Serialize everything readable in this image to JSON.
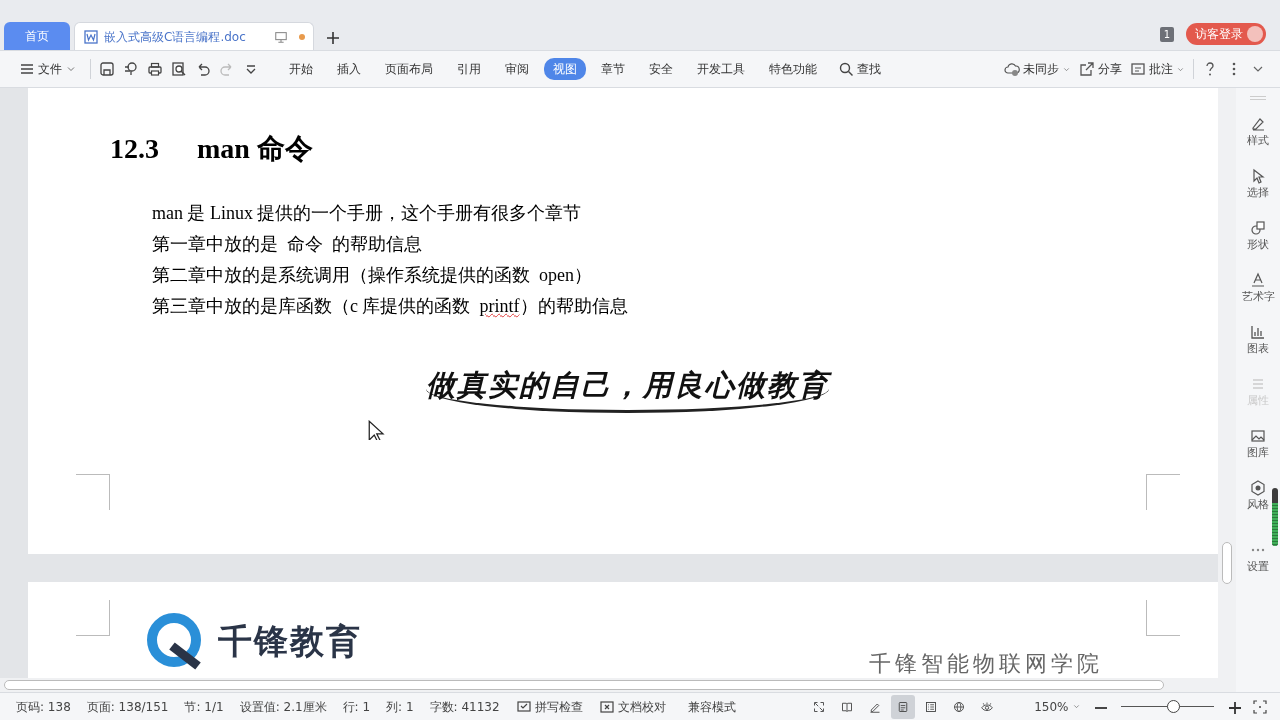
{
  "tabs": [
    {
      "label": "首页",
      "kind": "home",
      "selected": false
    },
    {
      "label": "嵌入式高级C语言编程.doc",
      "kind": "document",
      "selected": true,
      "modified": true
    }
  ],
  "window_count": "1",
  "login_button": "访客登录",
  "file_menu": "文件",
  "ribbon_tabs": [
    {
      "label": "开始",
      "selected": false
    },
    {
      "label": "插入",
      "selected": false
    },
    {
      "label": "页面布局",
      "selected": false
    },
    {
      "label": "引用",
      "selected": false
    },
    {
      "label": "审阅",
      "selected": false
    },
    {
      "label": "视图",
      "selected": true
    },
    {
      "label": "章节",
      "selected": false
    },
    {
      "label": "安全",
      "selected": false
    },
    {
      "label": "开发工具",
      "selected": false
    },
    {
      "label": "特色功能",
      "selected": false
    }
  ],
  "search": "查找",
  "right_actions": [
    {
      "label": "未同步",
      "kind": "sync"
    },
    {
      "label": "分享",
      "kind": "share"
    },
    {
      "label": "批注",
      "kind": "comment"
    }
  ],
  "document": {
    "heading_number": "12.3",
    "heading_title": "man 命令",
    "paragraphs": [
      [
        {
          "text": "man 是 Linux 提供的一个手册，这个手册有很多个章节",
          "misspelled": false
        }
      ],
      [
        {
          "text": "第一章中放的是  命令  的帮助信息",
          "misspelled": false
        }
      ],
      [
        {
          "text": "第二章中放的是系统调用（操作系统提供的函数  open）",
          "misspelled": false
        }
      ],
      [
        {
          "text": "第三章中放的是库函数（c 库提供的函数  ",
          "misspelled": false
        },
        {
          "text": "printf",
          "misspelled": true
        },
        {
          "text": "）的帮助信息",
          "misspelled": false
        }
      ]
    ],
    "slogan": "做真实的自己，用良心做教育",
    "logo_text": "千锋教育",
    "subtitle": "千锋智能物联网学院"
  },
  "side_panel": [
    {
      "label": "样式",
      "kind": "style",
      "disabled": false
    },
    {
      "label": "选择",
      "kind": "select",
      "disabled": false
    },
    {
      "label": "形状",
      "kind": "shape",
      "disabled": false
    },
    {
      "label": "艺术字",
      "kind": "art",
      "disabled": false
    },
    {
      "label": "图表",
      "kind": "chart",
      "disabled": false
    },
    {
      "label": "属性",
      "kind": "props",
      "disabled": true
    },
    {
      "label": "图库",
      "kind": "gallery",
      "disabled": false
    },
    {
      "label": "风格",
      "kind": "theme",
      "disabled": false
    },
    {
      "label": "设置",
      "kind": "more",
      "disabled": false
    }
  ],
  "status_items": [
    "页码: 138",
    "页面: 138/151",
    "节: 1/1",
    "设置值: 2.1厘米",
    "行: 1",
    "列: 1",
    "字数: 41132"
  ],
  "status_buttons": [
    {
      "label": "拼写检查",
      "kind": "spell"
    },
    {
      "label": "文档校对",
      "kind": "proof"
    }
  ],
  "mode": "兼容模式",
  "view_modes": [
    {
      "kind": "fullscreen",
      "selected": false
    },
    {
      "kind": "read",
      "selected": false
    },
    {
      "kind": "write",
      "selected": false
    },
    {
      "kind": "page",
      "selected": true
    },
    {
      "kind": "outline",
      "selected": false
    },
    {
      "kind": "web",
      "selected": false
    },
    {
      "kind": "eye",
      "selected": false
    }
  ],
  "zoom": {
    "reading": "150%",
    "level": 0.56
  }
}
